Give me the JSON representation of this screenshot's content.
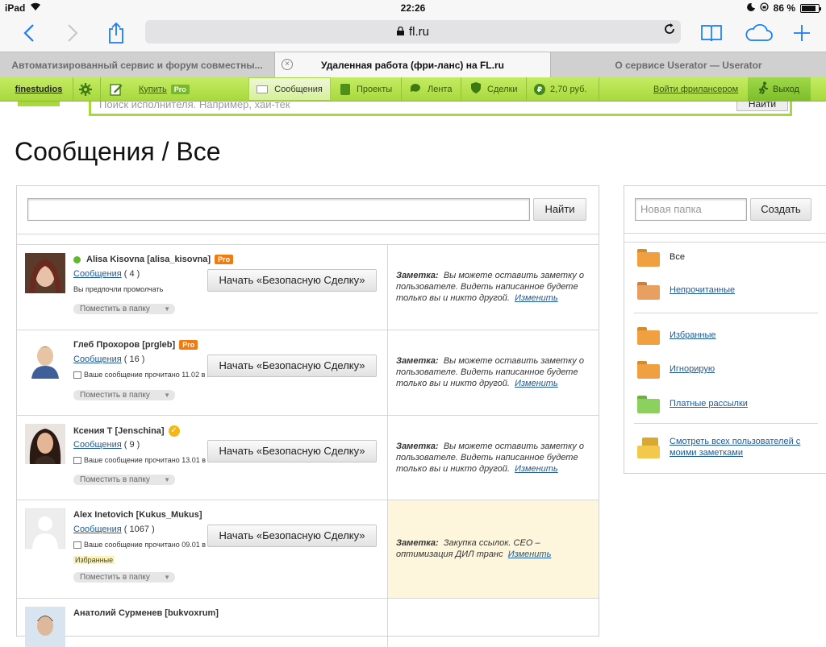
{
  "status_bar": {
    "device": "iPad",
    "time": "22:26",
    "battery": "86 %",
    "battery_level": 0.86
  },
  "browser": {
    "url": "fl.ru",
    "tabs": [
      {
        "title": "Автоматизированный сервис и форум совместны..."
      },
      {
        "title": "Удаленная работа (фри-ланс) на FL.ru"
      },
      {
        "title": "О сервисе Userator — Userator"
      }
    ]
  },
  "toolbar": {
    "logo": "finestudios",
    "buy": "Купить",
    "pro_badge": "Pro",
    "messages": "Сообщения",
    "projects": "Проекты",
    "feed": "Лента",
    "deals": "Сделки",
    "balance": "2,70 руб.",
    "freelancer_login": "Войти фрилансером",
    "logout": "Выход"
  },
  "top_search": {
    "placeholder": "Поиск исполнителя. Например, хай-тек",
    "button": "Найти"
  },
  "page": {
    "title": "Сообщения / Все"
  },
  "message_search": {
    "button": "Найти",
    "value": ""
  },
  "messages": [
    {
      "name": "Alisa Kisovna [alisa_kisovna]",
      "pro": "Pro",
      "messages_link": "Сообщения",
      "count": "( 4 )",
      "status": "Вы предпочли промолчать",
      "folder": "Поместить в папку",
      "deal_button": "Начать «Безопасную Сделку»",
      "note_label": "Заметка:",
      "note_text": "Вы можете оставить заметку о пользователе. Видеть написанное будете только вы и никто другой.",
      "note_link": "Изменить"
    },
    {
      "name": "Глеб Прохоров [prgleb]",
      "pro": "Pro",
      "messages_link": "Сообщения",
      "count": "( 16 )",
      "status": "Ваше сообщение прочитано 11.02 в 20:26",
      "folder": "Поместить в папку",
      "deal_button": "Начать «Безопасную Сделку»",
      "note_label": "Заметка:",
      "note_text": "Вы можете оставить заметку о пользователе. Видеть написанное будете только вы и никто другой.",
      "note_link": "Изменить"
    },
    {
      "name": "Ксения Т [Jenschina]",
      "messages_link": "Сообщения",
      "count": "( 9 )",
      "status": "Ваше сообщение прочитано 13.01 в 16:47",
      "folder": "Поместить в папку",
      "deal_button": "Начать «Безопасную Сделку»",
      "note_label": "Заметка:",
      "note_text": "Вы можете оставить заметку о пользователе. Видеть написанное будете только вы и никто другой.",
      "note_link": "Изменить"
    },
    {
      "name": "Alex Inetovich [Kukus_Mukus]",
      "messages_link": "Сообщения",
      "count": "( 1067 )",
      "status": "Ваше сообщение прочитано 09.01 в 22:23",
      "tag": "Избранные",
      "folder": "Поместить в папку",
      "deal_button": "Начать «Безопасную Сделку»",
      "note_label": "Заметка:",
      "note_text": "Закупка ссылок. СЕО – оптимизация ДИЛ транс",
      "note_link": "Изменить"
    },
    {
      "name": "Анатолий Сурменев [bukvoxrum]"
    }
  ],
  "sidebar": {
    "new_folder_placeholder": "Новая папка",
    "create_button": "Создать",
    "folders": [
      {
        "label": "Все",
        "color": "#f0a040"
      },
      {
        "label": "Непрочитанные",
        "color": "#e8a060"
      },
      {
        "label": "Избранные",
        "color": "#f0a040"
      },
      {
        "label": "Игнорирую",
        "color": "#f0a040"
      },
      {
        "label": "Платные рассылки",
        "color": "#8cd060"
      },
      {
        "label": "Смотреть всех пользователей с моими заметками",
        "color": "#f2c94c"
      }
    ]
  },
  "colors": {
    "toolbar_green": "#a8d83e",
    "link": "#1e5a96",
    "pro_orange": "#f07b12",
    "note_yellow": "#fdf6dd",
    "ios_blue": "#1a7cf5"
  }
}
